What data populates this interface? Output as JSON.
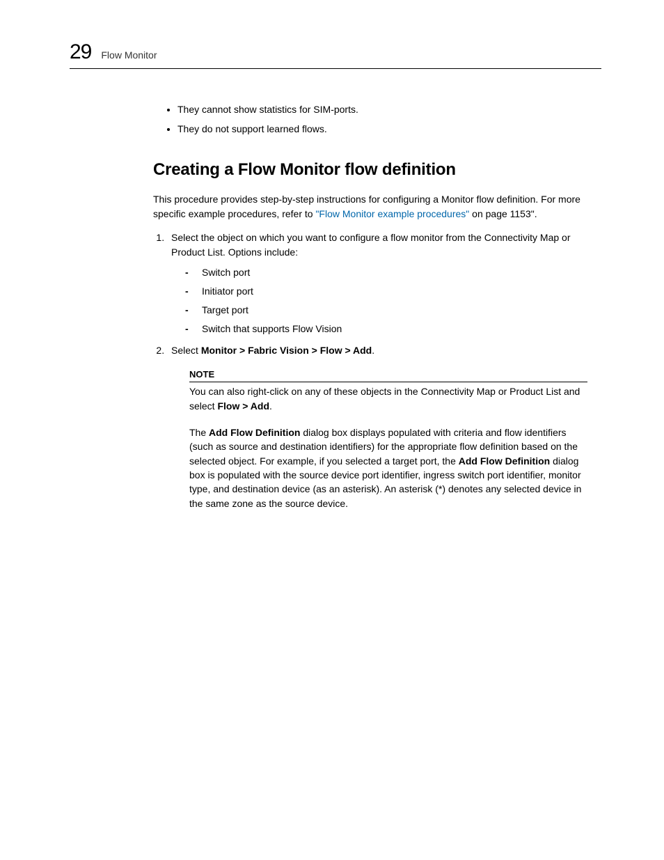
{
  "header": {
    "chapter_number": "29",
    "chapter_title": "Flow Monitor"
  },
  "bullets": [
    "They cannot show statistics for SIM-ports.",
    "They do not support learned flows."
  ],
  "section_heading": "Creating a Flow Monitor flow definition",
  "intro_before_link": "This procedure provides step-by-step instructions for configuring a Monitor flow definition. For more specific example procedures, refer to ",
  "intro_link": "\"Flow Monitor example procedures\"",
  "intro_after_link": " on page 1153\".",
  "steps": {
    "s1_lead": "Select the object on which you want to configure a flow monitor from the Connectivity Map or Product List. Options include:",
    "s1_items": [
      "Switch port",
      "Initiator port",
      "Target port",
      "Switch that supports Flow Vision"
    ],
    "s2_prefix": "Select ",
    "s2_bold": "Monitor > Fabric Vision > Flow > Add",
    "s2_suffix": "."
  },
  "note": {
    "label": "NOTE",
    "body_prefix": "You can also right-click on any of these objects in the Connectivity Map or Product List and select ",
    "body_bold": "Flow > Add",
    "body_suffix": "."
  },
  "followup": {
    "t1": "The ",
    "b1": "Add Flow Definition",
    "t2": " dialog box displays populated with criteria and flow identifiers (such as source and destination identifiers) for the appropriate flow definition based on the selected object. For example, if you selected a target port, the ",
    "b2": "Add Flow Definition",
    "t3": " dialog box is populated with the source device port identifier, ingress switch port identifier, monitor type, and destination device (as an asterisk). An asterisk (*) denotes any selected device in the same zone as the source device."
  }
}
